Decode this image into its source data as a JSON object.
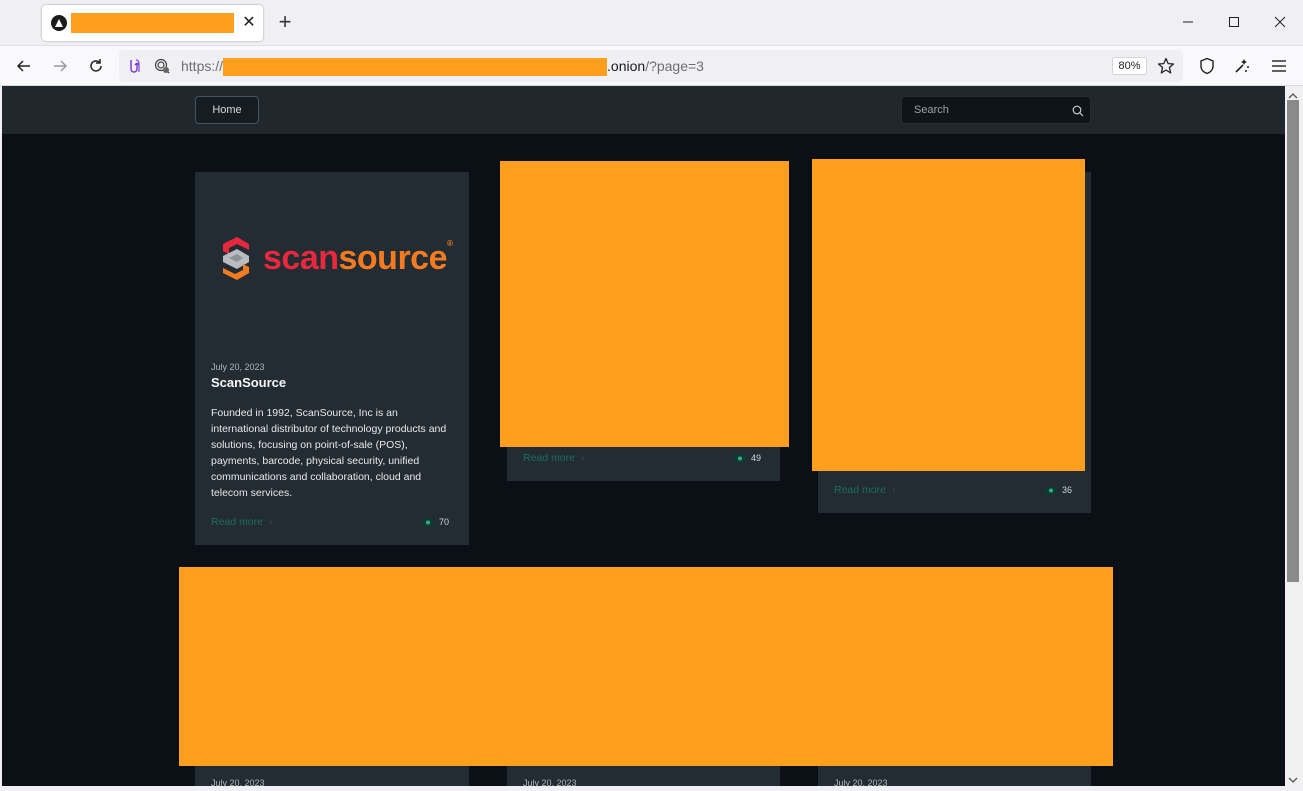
{
  "browser": {
    "tab_title": "",
    "close_tab_glyph": "✕",
    "new_tab_glyph": "+",
    "url": {
      "scheme": "https://",
      "host_suffix": ".onion",
      "path": "/?page=3"
    },
    "zoom": "80%"
  },
  "site": {
    "nav": {
      "home_label": "Home"
    },
    "search": {
      "placeholder": "Search"
    },
    "posts": [
      {
        "date": "July 20, 2023",
        "title": "ScanSource",
        "logo": {
          "part1": "scan",
          "part2": "source",
          "reg": "®"
        },
        "description": "Founded in 1992, ScanSource, Inc is an international distributor of technology products and solutions, focusing on point-of-sale (POS), payments, barcode, physical security, unified communications and collaboration, cloud and telecom services.",
        "read_more": "Read more",
        "views": "70"
      },
      {
        "read_more": "Read more",
        "views": "49"
      },
      {
        "read_more": "Read more",
        "views": "36"
      },
      {
        "date": "July 20, 2023"
      },
      {
        "date": "July 20, 2023"
      },
      {
        "date": "July 20, 2023"
      }
    ]
  },
  "colors": {
    "redaction": "#ff9f1e",
    "page_bg": "#0a1015",
    "card_bg": "#242c33",
    "accent_link": "#1a6e5a"
  },
  "icons": [
    "tab-site-icon",
    "close-icon",
    "plus-icon",
    "minimize-icon",
    "maximize-icon",
    "window-close-icon",
    "back-arrow-icon",
    "forward-arrow-icon",
    "reload-icon",
    "permissions-icon",
    "tracking-protection-icon",
    "star-icon",
    "shield-icon",
    "extension-icon",
    "hamburger-menu-icon",
    "search-icon",
    "eye-icon",
    "chevron-right-icon"
  ]
}
